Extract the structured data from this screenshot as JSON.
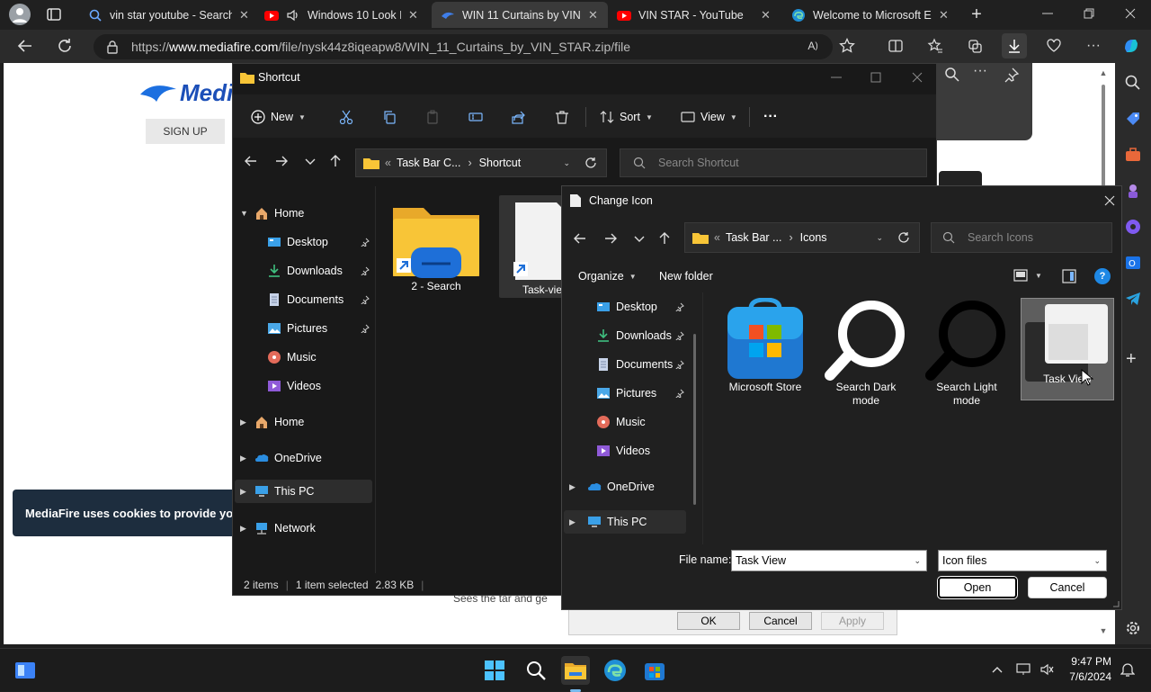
{
  "browser": {
    "tabs": [
      {
        "title": "vin star youtube - Search",
        "icon": "search-icon"
      },
      {
        "title": "Windows 10 Look I",
        "icon": "youtube-icon"
      },
      {
        "title": "WIN 11 Curtains by VIN",
        "icon": "mediafire-icon",
        "active": true
      },
      {
        "title": "VIN STAR - YouTube",
        "icon": "youtube-icon"
      },
      {
        "title": "Welcome to Microsoft E",
        "icon": "edge-icon"
      }
    ],
    "url_prefix": "https://",
    "url_domain": "www.mediafire.com",
    "url_path": "/file/nysk44z8iqeapw8/WIN_11_Curtains_by_VIN_STAR.zip/file"
  },
  "webpage": {
    "logo_text": "Medi",
    "signup_label": "SIGN UP",
    "cookie_text": "MediaFire uses cookies to provide you w",
    "footer_text": "Sees the tar and ge",
    "ok_label": "OK",
    "cancel_label": "Cancel",
    "apply_label": "Apply"
  },
  "explorer": {
    "title": "Shortcut",
    "cmd": {
      "new": "New",
      "sort": "Sort",
      "view": "View"
    },
    "breadcrumb": [
      "Task Bar C...",
      "Shortcut"
    ],
    "search_placeholder": "Search Shortcut",
    "nav": [
      {
        "label": "Home",
        "icon": "home-icon",
        "indent": 0,
        "expanded": true
      },
      {
        "label": "Desktop",
        "icon": "desktop-icon",
        "indent": 1,
        "pinned": true
      },
      {
        "label": "Downloads",
        "icon": "downloads-icon",
        "indent": 1,
        "pinned": true
      },
      {
        "label": "Documents",
        "icon": "documents-icon",
        "indent": 1,
        "pinned": true
      },
      {
        "label": "Pictures",
        "icon": "pictures-icon",
        "indent": 1,
        "pinned": true
      },
      {
        "label": "Music",
        "icon": "music-icon",
        "indent": 1
      },
      {
        "label": "Videos",
        "icon": "videos-icon",
        "indent": 1
      },
      {
        "label": "Home",
        "icon": "home-icon",
        "indent": 0
      },
      {
        "label": "OneDrive",
        "icon": "onedrive-icon",
        "indent": 0
      },
      {
        "label": "This PC",
        "icon": "pc-icon",
        "indent": 0,
        "selected": true
      },
      {
        "label": "Network",
        "icon": "network-icon",
        "indent": 0
      }
    ],
    "files": [
      {
        "label": "2 - Search",
        "icon": "folder-shortcut-icon"
      },
      {
        "label": "Task-vie",
        "icon": "file-shortcut-icon"
      }
    ],
    "status": {
      "items": "2 items",
      "selected": "1 item selected",
      "size": "2.83 KB"
    }
  },
  "dialog": {
    "title": "Change Icon",
    "breadcrumb": [
      "Task Bar ...",
      "Icons"
    ],
    "search_placeholder": "Search Icons",
    "organize_label": "Organize",
    "new_folder_label": "New folder",
    "nav": [
      {
        "label": "Desktop",
        "icon": "desktop-icon",
        "pinned": true
      },
      {
        "label": "Downloads",
        "icon": "downloads-icon",
        "pinned": true
      },
      {
        "label": "Documents",
        "icon": "documents-icon",
        "pinned": true
      },
      {
        "label": "Pictures",
        "icon": "pictures-icon",
        "pinned": true
      },
      {
        "label": "Music",
        "icon": "music-icon"
      },
      {
        "label": "Videos",
        "icon": "videos-icon"
      },
      {
        "label": "OneDrive",
        "icon": "onedrive-icon",
        "top": true
      },
      {
        "label": "This PC",
        "icon": "pc-icon",
        "top": true,
        "selected": true
      }
    ],
    "items": [
      {
        "label": "Microsoft Store",
        "icon": "store-icon"
      },
      {
        "label": "Search Dark mode",
        "label1": "Search Dark",
        "label2": "mode",
        "icon": "search-dark-icon"
      },
      {
        "label": "Search Light mode",
        "label1": "Search Light",
        "label2": "mode",
        "icon": "search-light-icon"
      },
      {
        "label": "Task View",
        "icon": "task-view-icon",
        "selected": true
      }
    ],
    "filename_label": "File name:",
    "filename_value": "Task View",
    "filetype_value": "Icon files",
    "open_label": "Open",
    "cancel_label": "Cancel"
  },
  "taskbar": {
    "time": "9:47 PM",
    "date": "7/6/2024"
  },
  "colors": {
    "accent": "#0078d4",
    "folder": "#f8c537",
    "selected": "#3a3a3a"
  }
}
